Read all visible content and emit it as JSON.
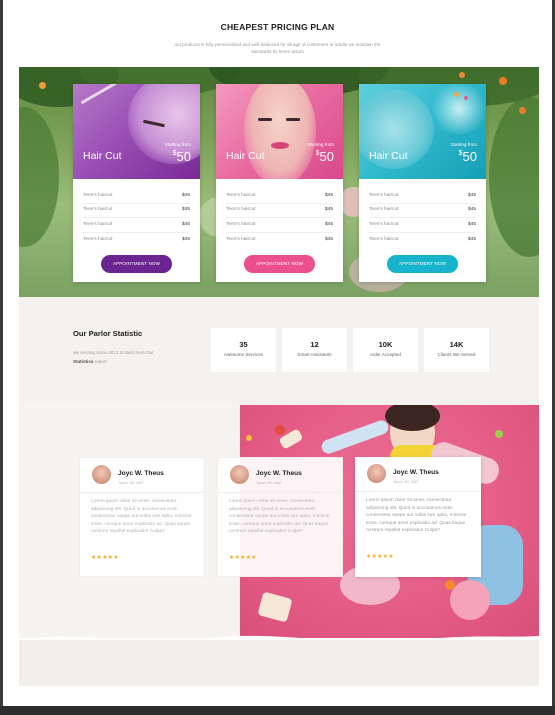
{
  "header": {
    "title": "CHEAPEST PRICING PLAN",
    "subtitle": "out products is fully personalized and well balanced for all age of customers or adults we maintain the standards by lorem ipsum"
  },
  "pricing": {
    "cards": [
      {
        "name": "Hair Cut",
        "from_label": "Starting from",
        "currency": "$",
        "price": "50",
        "color": "#7a2a96",
        "items": [
          {
            "label": "Teen's haircut",
            "price": "$45"
          },
          {
            "label": "Teen's haircut",
            "price": "$45"
          },
          {
            "label": "Teen's haircut",
            "price": "$45"
          },
          {
            "label": "Teen's haircut",
            "price": "$45"
          }
        ],
        "button": "APPOINTMENT NOW"
      },
      {
        "name": "Hair Cut",
        "from_label": "Starting from",
        "currency": "$",
        "price": "50",
        "color": "#ec4f8d",
        "items": [
          {
            "label": "Teen's haircut",
            "price": "$45"
          },
          {
            "label": "Teen's haircut",
            "price": "$45"
          },
          {
            "label": "Teen's haircut",
            "price": "$45"
          },
          {
            "label": "Teen's haircut",
            "price": "$45"
          }
        ],
        "button": "APPOINTMENT NOW"
      },
      {
        "name": "Hair Cut",
        "from_label": "Starting from",
        "currency": "$",
        "price": "50",
        "color": "#1ab5cd",
        "items": [
          {
            "label": "Teen's haircut",
            "price": "$45"
          },
          {
            "label": "Teen's haircut",
            "price": "$45"
          },
          {
            "label": "Teen's haircut",
            "price": "$45"
          },
          {
            "label": "Teen's haircut",
            "price": "$45"
          }
        ],
        "button": "APPOINTMENT NOW"
      }
    ]
  },
  "statistic": {
    "heading": "Our Parlor Statistic",
    "desc_prefix": "we serving since 2013 to Beirt here Our",
    "desc_strong": "Statistics",
    "desc_suffix": "report",
    "items": [
      {
        "value": "35",
        "label": "Awesome Services"
      },
      {
        "value": "12",
        "label": "Smart Assistants"
      },
      {
        "value": "10K",
        "label": "order Accepted"
      },
      {
        "value": "14K",
        "label": "Clients We Served"
      }
    ]
  },
  "testimonials": [
    {
      "name": "Joyc W. Theus",
      "location": "Tyson, NS 2887",
      "text": "Lorem ipsum dolor sit amet, consectetur adipisicing elit. Quod in accusamus enim consectetur saepe aut nobis iure optio, minima! Esse, cumque amet explicabo ad. Quas itaque nostrum repellat explicabo! Culpa?",
      "stars": "★★★★★"
    },
    {
      "name": "Joyc W. Theus",
      "location": "Tyson, NS 2887",
      "text": "Lorem ipsum dolor sit amet, consectetur adipisicing elit. Quod in accusamus enim consectetur saepe aut nobis iure optio, minima! Esse, cumque amet explicabo ad. Quas itaque nostrum repellat explicabo! Culpa?",
      "stars": "★★★★★"
    },
    {
      "name": "Joyc W. Theus",
      "location": "Tyson, NS 2887",
      "text": "Lorem ipsum dolor sit amet, consectetur adipisicing elit. Quod in accusamus enim consectetur saepe aut nobis iure optio, minima! Esse, cumque amet explicabo ad. Quas itaque nostrum repellat explicabo! Culpa?",
      "stars": "★★★★★"
    }
  ]
}
